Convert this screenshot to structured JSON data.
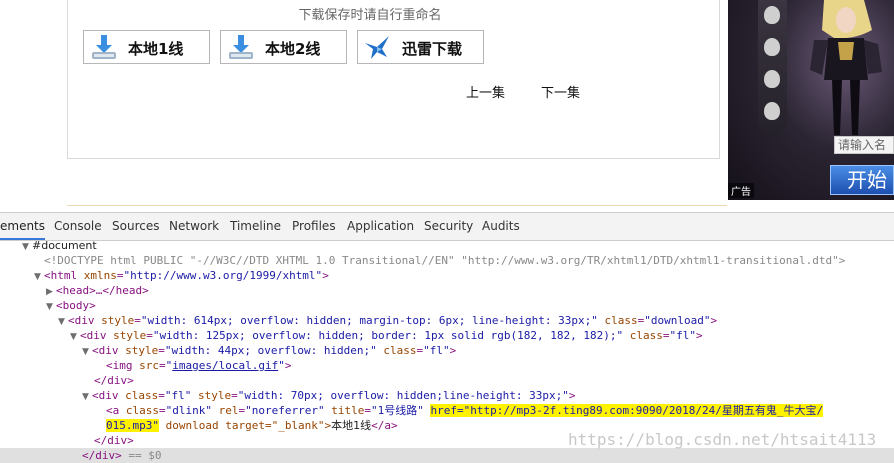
{
  "page": {
    "download_hint": "下载保存时请自行重命名",
    "buttons": {
      "local1": "本地1线",
      "local2": "本地2线",
      "thunder": "迅雷下载"
    },
    "prev_episode": "上一集",
    "next_episode": "下一集"
  },
  "ad": {
    "input_placeholder": "请输入名",
    "start_label": "开始",
    "tag": "广告"
  },
  "devtools": {
    "tabs": [
      "ements",
      "Console",
      "Sources",
      "Network",
      "Timeline",
      "Profiles",
      "Application",
      "Security",
      "Audits"
    ],
    "active_tab": "ements",
    "lines": {
      "l0": "#document",
      "l1": "<!DOCTYPE html PUBLIC \"-//W3C//DTD XHTML 1.0 Transitional//EN\" \"http://www.w3.org/TR/xhtml1/DTD/xhtml1-transitional.dtd\">",
      "l2_tag_open": "<html ",
      "l2_attr": "xmlns",
      "l2_val": "\"http://www.w3.org/1999/xhtml\"",
      "l2_close": ">",
      "l3": "<head>…</head>",
      "l4": "<body>",
      "l5_attr1": "style",
      "l5_val1": "\"width: 614px; overflow: hidden; margin-top: 6px; line-height: 33px;\"",
      "l5_attr2": "class",
      "l5_val2": "\"download\"",
      "l6_val1": "\"width: 125px; overflow: hidden; border: 1px solid rgb(182, 182, 182);\"",
      "l6_val2": "\"fl\"",
      "l7_val1": "\"width: 44px; overflow: hidden;\"",
      "l7_val2": "\"fl\"",
      "l8_attr": "src",
      "l8_val": "images/local.gif",
      "l9": "</div>",
      "l10_val1": "\"fl\"",
      "l10_val2": "\"width: 70px; overflow: hidden;line-height: 33px;\"",
      "l11_val_class": "\"dlink\"",
      "l11_val_rel": "\"noreferrer\"",
      "l11_val_title": "\"1号线路\"",
      "l11_href_a": "href=\"http://mp3-2f.ting89.com:9090/2018/24/星期五有鬼_牛大宝/",
      "l11_href_b": "015.mp3\"",
      "l11_rest": " download target=\"_blank\">",
      "l11_text": "本地1线",
      "l11_close": "</a>",
      "l12": "</div>",
      "l13": "</div>",
      "l13_eq": " == $0"
    },
    "watermark": "https://blog.csdn.net/htsait4113"
  }
}
